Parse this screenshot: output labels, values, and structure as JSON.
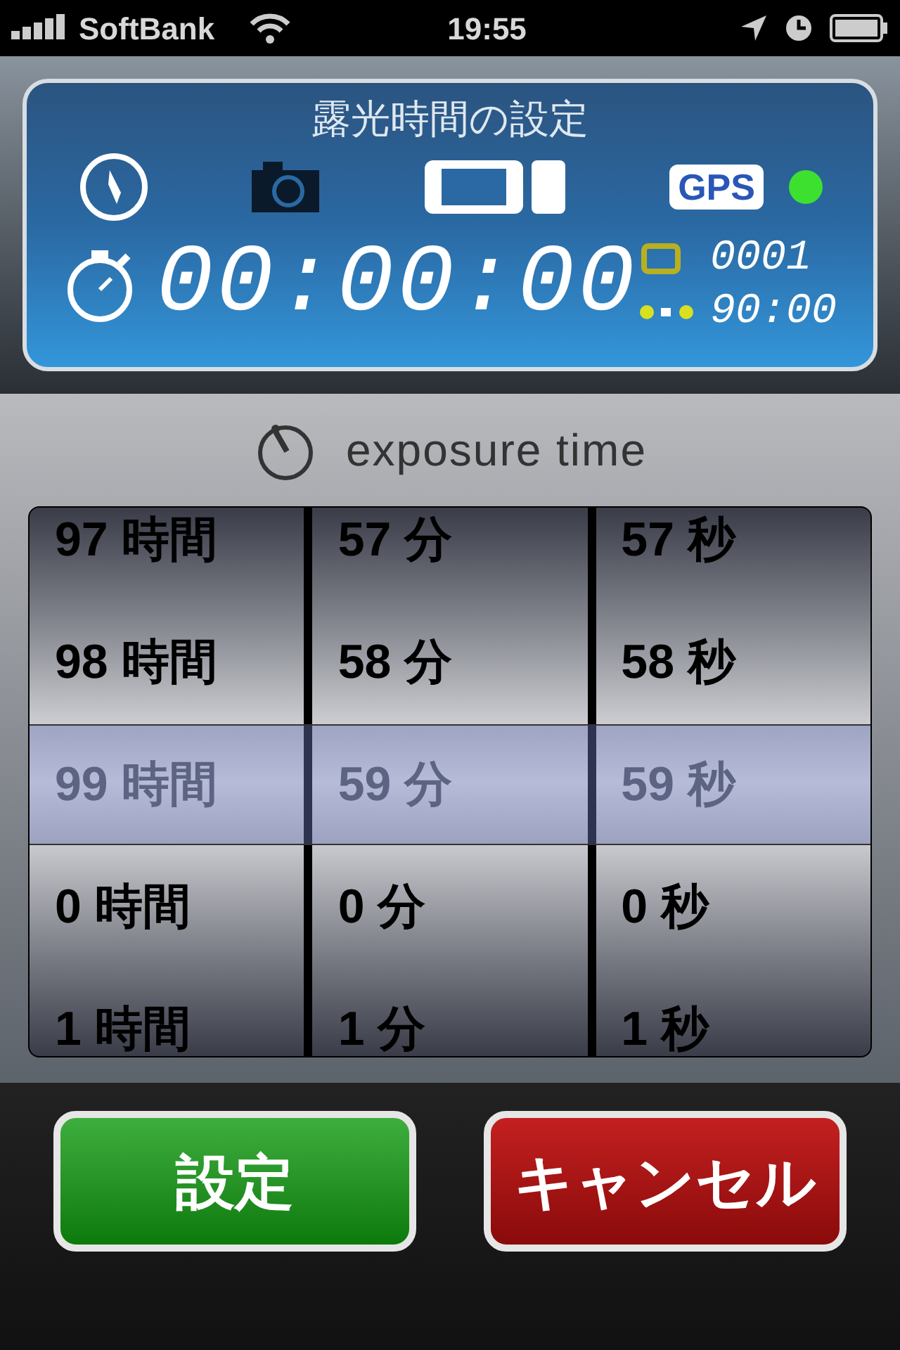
{
  "status_bar": {
    "carrier": "SoftBank",
    "time": "19:55"
  },
  "panel": {
    "title": "露光時間の設定",
    "gps_label": "GPS",
    "gps_on": true,
    "timer": "00:00:00",
    "counter": "0001",
    "interval": "90:00"
  },
  "picker": {
    "label": "exposure time",
    "columns": [
      {
        "rows": [
          {
            "label": "97 時間",
            "selected": false
          },
          {
            "label": "98 時間",
            "selected": false
          },
          {
            "label": "99 時間",
            "selected": true
          },
          {
            "label": "0 時間",
            "selected": false
          },
          {
            "label": "1 時間",
            "selected": false
          }
        ]
      },
      {
        "rows": [
          {
            "label": "57 分",
            "selected": false
          },
          {
            "label": "58 分",
            "selected": false
          },
          {
            "label": "59 分",
            "selected": true
          },
          {
            "label": "0 分",
            "selected": false
          },
          {
            "label": "1 分",
            "selected": false
          }
        ]
      },
      {
        "rows": [
          {
            "label": "57 秒",
            "selected": false
          },
          {
            "label": "58 秒",
            "selected": false
          },
          {
            "label": "59 秒",
            "selected": true
          },
          {
            "label": "0 秒",
            "selected": false
          },
          {
            "label": "1 秒",
            "selected": false
          }
        ]
      }
    ]
  },
  "buttons": [
    {
      "label": "設定",
      "kind": "confirm"
    },
    {
      "label": "キャンセル",
      "kind": "cancel"
    }
  ]
}
